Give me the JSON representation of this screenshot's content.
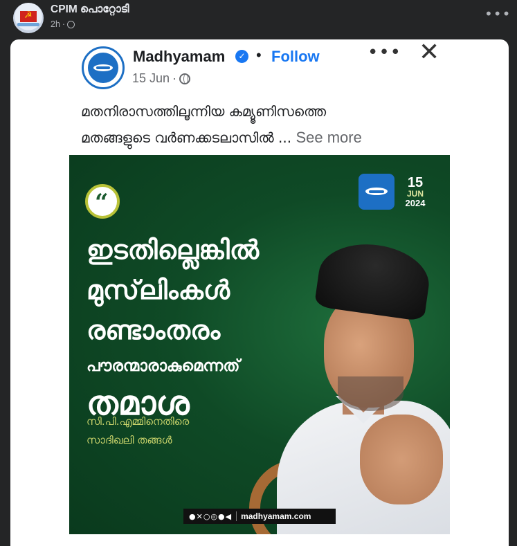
{
  "outer_post": {
    "author": "CPIM പൊറ്റോടി",
    "time": "2h",
    "more_icon": "more-horizontal-icon"
  },
  "embedded_post": {
    "page_name": "Madhyamam",
    "verified_icon": "verified-badge-icon",
    "separator": "•",
    "follow_label": "Follow",
    "date": "15 Jun",
    "caption_line1": "മതനിരാസത്തിലൂന്നിയ കമ്യൂണിസത്തെ",
    "caption_line2": "മതങ്ങളുടെ വർണക്കടലാസിൽ ...",
    "see_more": "See more",
    "close_icon": "close-icon",
    "more_icon": "more-horizontal-icon"
  },
  "poster": {
    "quote_mark": "“",
    "date_day": "15",
    "date_month": "JUN",
    "date_year": "2024",
    "headline_1": "ഇടതില്ലെങ്കിൽ",
    "headline_2": "മുസ്‌ലിംകൾ",
    "headline_3": "രണ്ടാംതരം",
    "headline_4": "പൗരന്മാരാകുമെന്നത്",
    "headline_5": "തമാശ",
    "subline_1": "സി.പി.എമ്മിനെതിരെ",
    "subline_2": "സാദിഖലി തങ്ങൾ",
    "social_icons": "●✕○◎●◀",
    "website": "madhyamam.com"
  },
  "colors": {
    "page_bg": "#242526",
    "card_bg": "#ffffff",
    "poster_green": "#0f4a26",
    "follow_blue": "#1877f2",
    "subline_yellow": "#c9d36b"
  }
}
